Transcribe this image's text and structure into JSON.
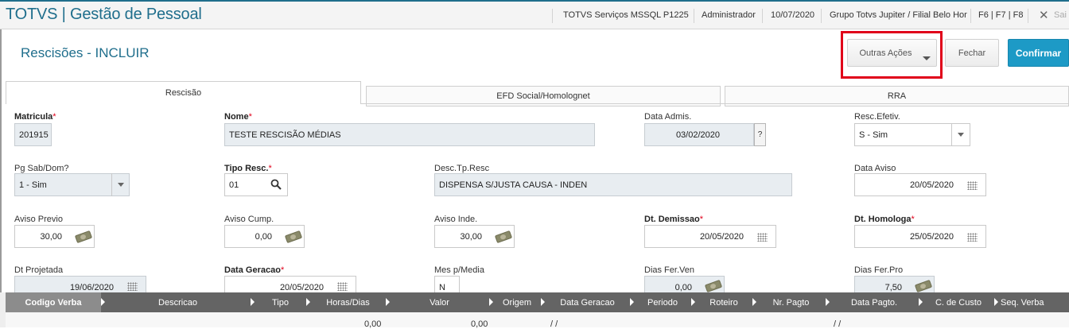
{
  "app": {
    "title": "TOTVS | Gestão de Pessoal",
    "server": "TOTVS Serviços MSSQL P1225",
    "user": "Administrador",
    "date": "10/07/2020",
    "branch": "Grupo Totvs Jupiter / Filial Belo Hor",
    "shortcuts": "F6 | F7 | F8",
    "exit_label": "Sai"
  },
  "page": {
    "title": "Rescisões - INCLUIR"
  },
  "actions": {
    "other_actions": "Outras Ações",
    "close": "Fechar",
    "confirm": "Confirmar"
  },
  "tabs": [
    "Rescisão",
    "EFD Social/Homolognet",
    "RRA"
  ],
  "form": {
    "matricula": {
      "label": "Matricula",
      "value": "201915"
    },
    "nome": {
      "label": "Nome",
      "value": "TESTE RESCISÃO MÉDIAS"
    },
    "data_admis": {
      "label": "Data Admis.",
      "value": "03/02/2020",
      "help": "?"
    },
    "resc_efetiv": {
      "label": "Resc.Efetiv.",
      "value": "S - Sim"
    },
    "pg_sab_dom": {
      "label": "Pg Sab/Dom?",
      "value": "1 - Sim"
    },
    "tipo_resc": {
      "label": "Tipo Resc.",
      "value": "01"
    },
    "desc_tp_resc": {
      "label": "Desc.Tp.Resc",
      "value": "DISPENSA S/JUSTA CAUSA - INDEN"
    },
    "data_aviso": {
      "label": "Data Aviso",
      "value": "20/05/2020"
    },
    "aviso_previo": {
      "label": "Aviso Previo",
      "value": "30,00"
    },
    "aviso_cump": {
      "label": "Aviso Cump.",
      "value": "0,00"
    },
    "aviso_inde": {
      "label": "Aviso Inde.",
      "value": "30,00"
    },
    "dt_demissao": {
      "label": "Dt. Demissao",
      "value": "20/05/2020"
    },
    "dt_homologa": {
      "label": "Dt. Homologa",
      "value": "25/05/2020"
    },
    "dt_projetada": {
      "label": "Dt Projetada",
      "value": "19/06/2020"
    },
    "data_geracao": {
      "label": "Data Geracao",
      "value": "20/05/2020"
    },
    "mes_media": {
      "label": "Mes p/Media",
      "value": "N"
    },
    "dias_fer_ven": {
      "label": "Dias Fer.Ven",
      "value": "0,00"
    },
    "dias_fer_pro": {
      "label": "Dias Fer.Pro",
      "value": "7,50"
    },
    "required_mark": "*"
  },
  "grid": {
    "columns": [
      "Codigo Verba",
      "Descricao",
      "Tipo",
      "Horas/Dias",
      "Valor",
      "Origem",
      "Data Geracao",
      "Periodo",
      "Roteiro",
      "Nr. Pagto",
      "Data Pagto.",
      "C. de Custo",
      "Seq. Verba"
    ],
    "row": {
      "horas": "0,00",
      "valor": "0,00",
      "data_geracao": "/ /",
      "data_pagto": "/ /"
    }
  },
  "colors": {
    "brand": "#1f6e8c",
    "confirm": "#1d9ac6",
    "highlight": "#e0001a"
  }
}
